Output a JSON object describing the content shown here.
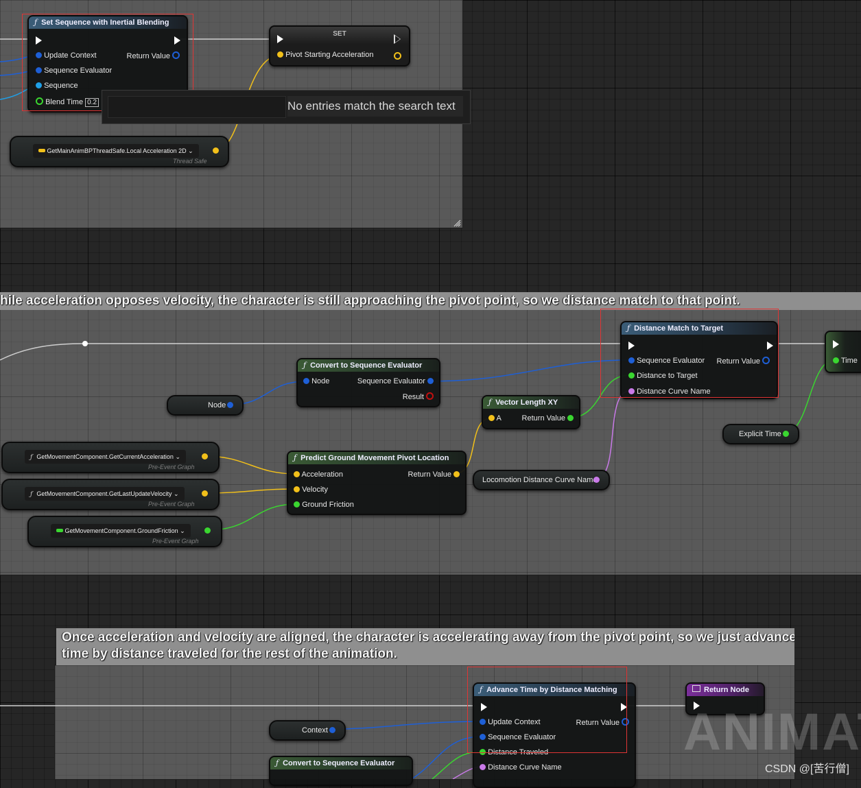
{
  "comments": {
    "middle_title": "hile acceleration opposes velocity, the character is still approaching the pivot point, so we distance match to that point.",
    "bottom_title_line1": "Once acceleration and velocity are aligned, the character is accelerating away from the pivot point, so we just advance",
    "bottom_title_line2": "time by distance traveled for the rest of the animation."
  },
  "nodes": {
    "set_sequence": {
      "title": "Set Sequence with Inertial Blending",
      "pins": {
        "update_context": "Update Context",
        "return_value": "Return Value",
        "sequence_evaluator": "Sequence Evaluator",
        "sequence": "Sequence",
        "blend_time": "Blend Time",
        "blend_time_value": "0.2"
      }
    },
    "set_var": {
      "title": "SET",
      "pin_label": "Pivot Starting Acceleration"
    },
    "getter_local_accel": {
      "label": "GetMainAnimBPThreadSafe.Local Acceleration 2D",
      "subtext": "Thread Safe"
    },
    "distance_match": {
      "title": "Distance Match to Target",
      "pins": {
        "sequence_evaluator": "Sequence Evaluator",
        "return_value": "Return Value",
        "distance_to_target": "Distance to Target",
        "distance_curve_name": "Distance Curve Name"
      }
    },
    "convert_seq_eval": {
      "title": "Convert to Sequence Evaluator",
      "pins": {
        "node": "Node",
        "sequence_evaluator": "Sequence Evaluator",
        "result": "Result"
      }
    },
    "node_var": {
      "label": "Node"
    },
    "vector_length": {
      "title": "Vector Length XY",
      "pins": {
        "a": "A",
        "return_value": "Return Value"
      }
    },
    "partial_node": {
      "pin": "Time"
    },
    "explicit_time": {
      "label": "Explicit Time"
    },
    "getter_current_accel": {
      "label": "GetMovementComponent.GetCurrentAcceleration",
      "subtext": "Pre-Event Graph"
    },
    "getter_last_velocity": {
      "label": "GetMovementComponent.GetLastUpdateVelocity",
      "subtext": "Pre-Event Graph"
    },
    "getter_ground_friction": {
      "label": "GetMovementComponent.GroundFriction",
      "subtext": "Pre-Event Graph"
    },
    "predict_pivot": {
      "title": "Predict Ground Movement Pivot Location",
      "pins": {
        "acceleration": "Acceleration",
        "return_value": "Return Value",
        "velocity": "Velocity",
        "ground_friction": "Ground Friction"
      }
    },
    "curve_name_var": {
      "label": "Locomotion Distance Curve Name"
    },
    "advance_time": {
      "title": "Advance Time by Distance Matching",
      "pins": {
        "update_context": "Update Context",
        "return_value": "Return Value",
        "sequence_evaluator": "Sequence Evaluator",
        "distance_traveled": "Distance Traveled",
        "distance_curve_name": "Distance Curve Name"
      }
    },
    "return_node": {
      "title": "Return Node"
    },
    "context_var": {
      "label": "Context"
    },
    "convert_seq_eval_2": {
      "title": "Convert to Sequence Evaluator"
    }
  },
  "search_popup": {
    "message": "No entries match the search text"
  },
  "watermark": {
    "animat": "ANIMAT",
    "csdn": "CSDN @[苦行僧]"
  },
  "colors": {
    "struct_pin": "#1e5fd6",
    "vector_pin": "#f2c01a",
    "float_pin": "#3ad630",
    "name_pin": "#c97ae8",
    "sequence_pin": "#1fa0e8",
    "exec_pin": "#ffffff",
    "selection_box": "#e03535"
  },
  "icons": [
    "function-icon",
    "exec-pin-icon",
    "dropdown-chevron-icon",
    "resize-grip-icon",
    "variable-icon"
  ]
}
